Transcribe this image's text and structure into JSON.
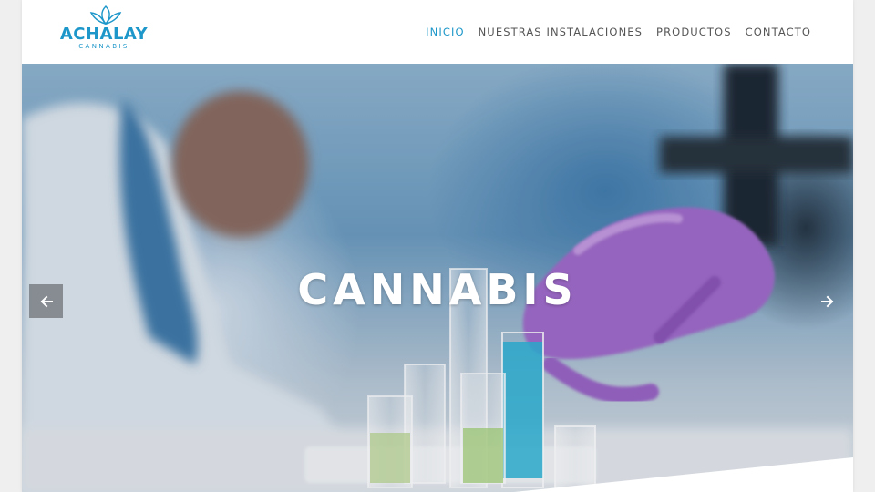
{
  "brand": {
    "name": "ACHALAY",
    "tagline": "CANNABIS",
    "color": "#1d97c9"
  },
  "nav": {
    "items": [
      {
        "label": "INICIO",
        "active": true
      },
      {
        "label": "NUESTRAS INSTALACIONES",
        "active": false
      },
      {
        "label": "PRODUCTOS",
        "active": false
      },
      {
        "label": "CONTACTO",
        "active": false
      }
    ],
    "text_color": "#555555",
    "active_color": "#1d97c9"
  },
  "hero": {
    "title": "CANNABIS",
    "image_subject": "lab scientist with purple glove and test tubes",
    "prev_icon": "arrow-left-icon",
    "next_icon": "arrow-right-icon"
  }
}
